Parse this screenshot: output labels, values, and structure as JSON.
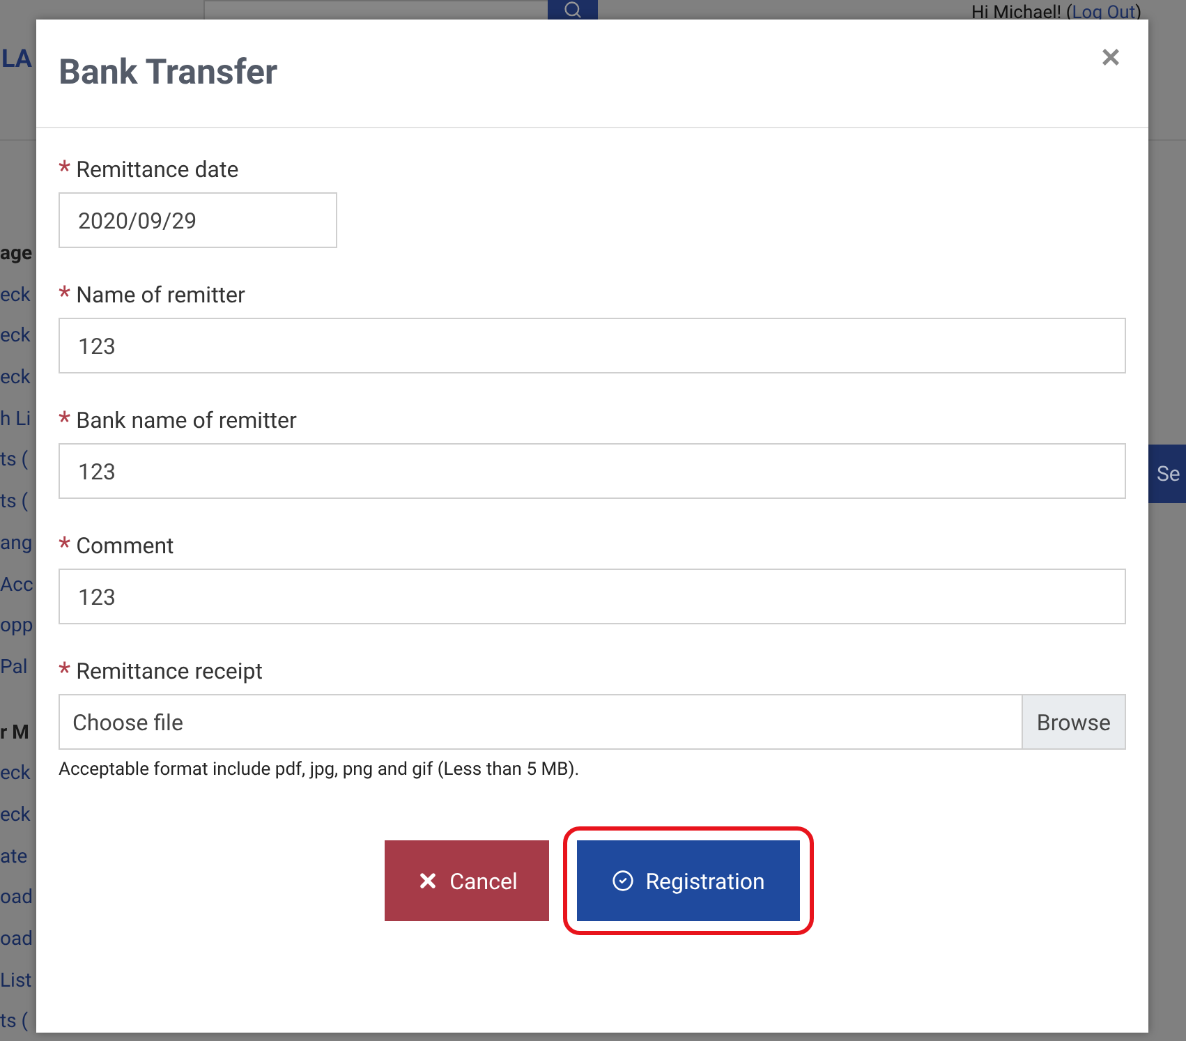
{
  "page": {
    "logo": "LA",
    "greeting": "Hi Michael! (",
    "logout_link": "Log Out",
    "greeting_end": ")",
    "search_button_label": "Se",
    "sidebar": [
      {
        "kind": "heading",
        "text": "age"
      },
      {
        "kind": "link",
        "text": "eck"
      },
      {
        "kind": "link",
        "text": "eck"
      },
      {
        "kind": "link",
        "text": "eck"
      },
      {
        "kind": "link",
        "text": "h Li"
      },
      {
        "kind": "link",
        "text": "ts ("
      },
      {
        "kind": "link",
        "text": "ts ("
      },
      {
        "kind": "link",
        "text": "ang"
      },
      {
        "kind": "link",
        "text": "Acc"
      },
      {
        "kind": "link",
        "text": "opp"
      },
      {
        "kind": "link",
        "text": "Pal"
      },
      {
        "kind": "heading",
        "text": "r M"
      },
      {
        "kind": "link",
        "text": "eck"
      },
      {
        "kind": "link",
        "text": "eck"
      },
      {
        "kind": "link",
        "text": "ate"
      },
      {
        "kind": "link",
        "text": "oad"
      },
      {
        "kind": "link",
        "text": "oad"
      },
      {
        "kind": "link",
        "text": "List"
      },
      {
        "kind": "link",
        "text": "ts ("
      }
    ]
  },
  "modal": {
    "title": "Bank Transfer",
    "close": "×",
    "fields": [
      {
        "kind": "date",
        "required_mark": "*",
        "label": "Remittance date",
        "value": "2020/09/29"
      },
      {
        "kind": "text",
        "required_mark": "*",
        "label": "Name of remitter",
        "value": "123"
      },
      {
        "kind": "text",
        "required_mark": "*",
        "label": "Bank name of remitter",
        "value": "123"
      },
      {
        "kind": "text",
        "required_mark": "*",
        "label": "Comment",
        "value": "123"
      },
      {
        "kind": "file",
        "required_mark": "*",
        "label": "Remittance receipt",
        "value": "Choose file",
        "button": "Browse"
      }
    ],
    "help": "Acceptable format include pdf, jpg, png and gif (Less than 5 MB).",
    "buttons": [
      {
        "kind": "cancel",
        "label": "Cancel",
        "highlighted": false
      },
      {
        "kind": "submit",
        "label": "Registration",
        "highlighted": true
      }
    ]
  }
}
